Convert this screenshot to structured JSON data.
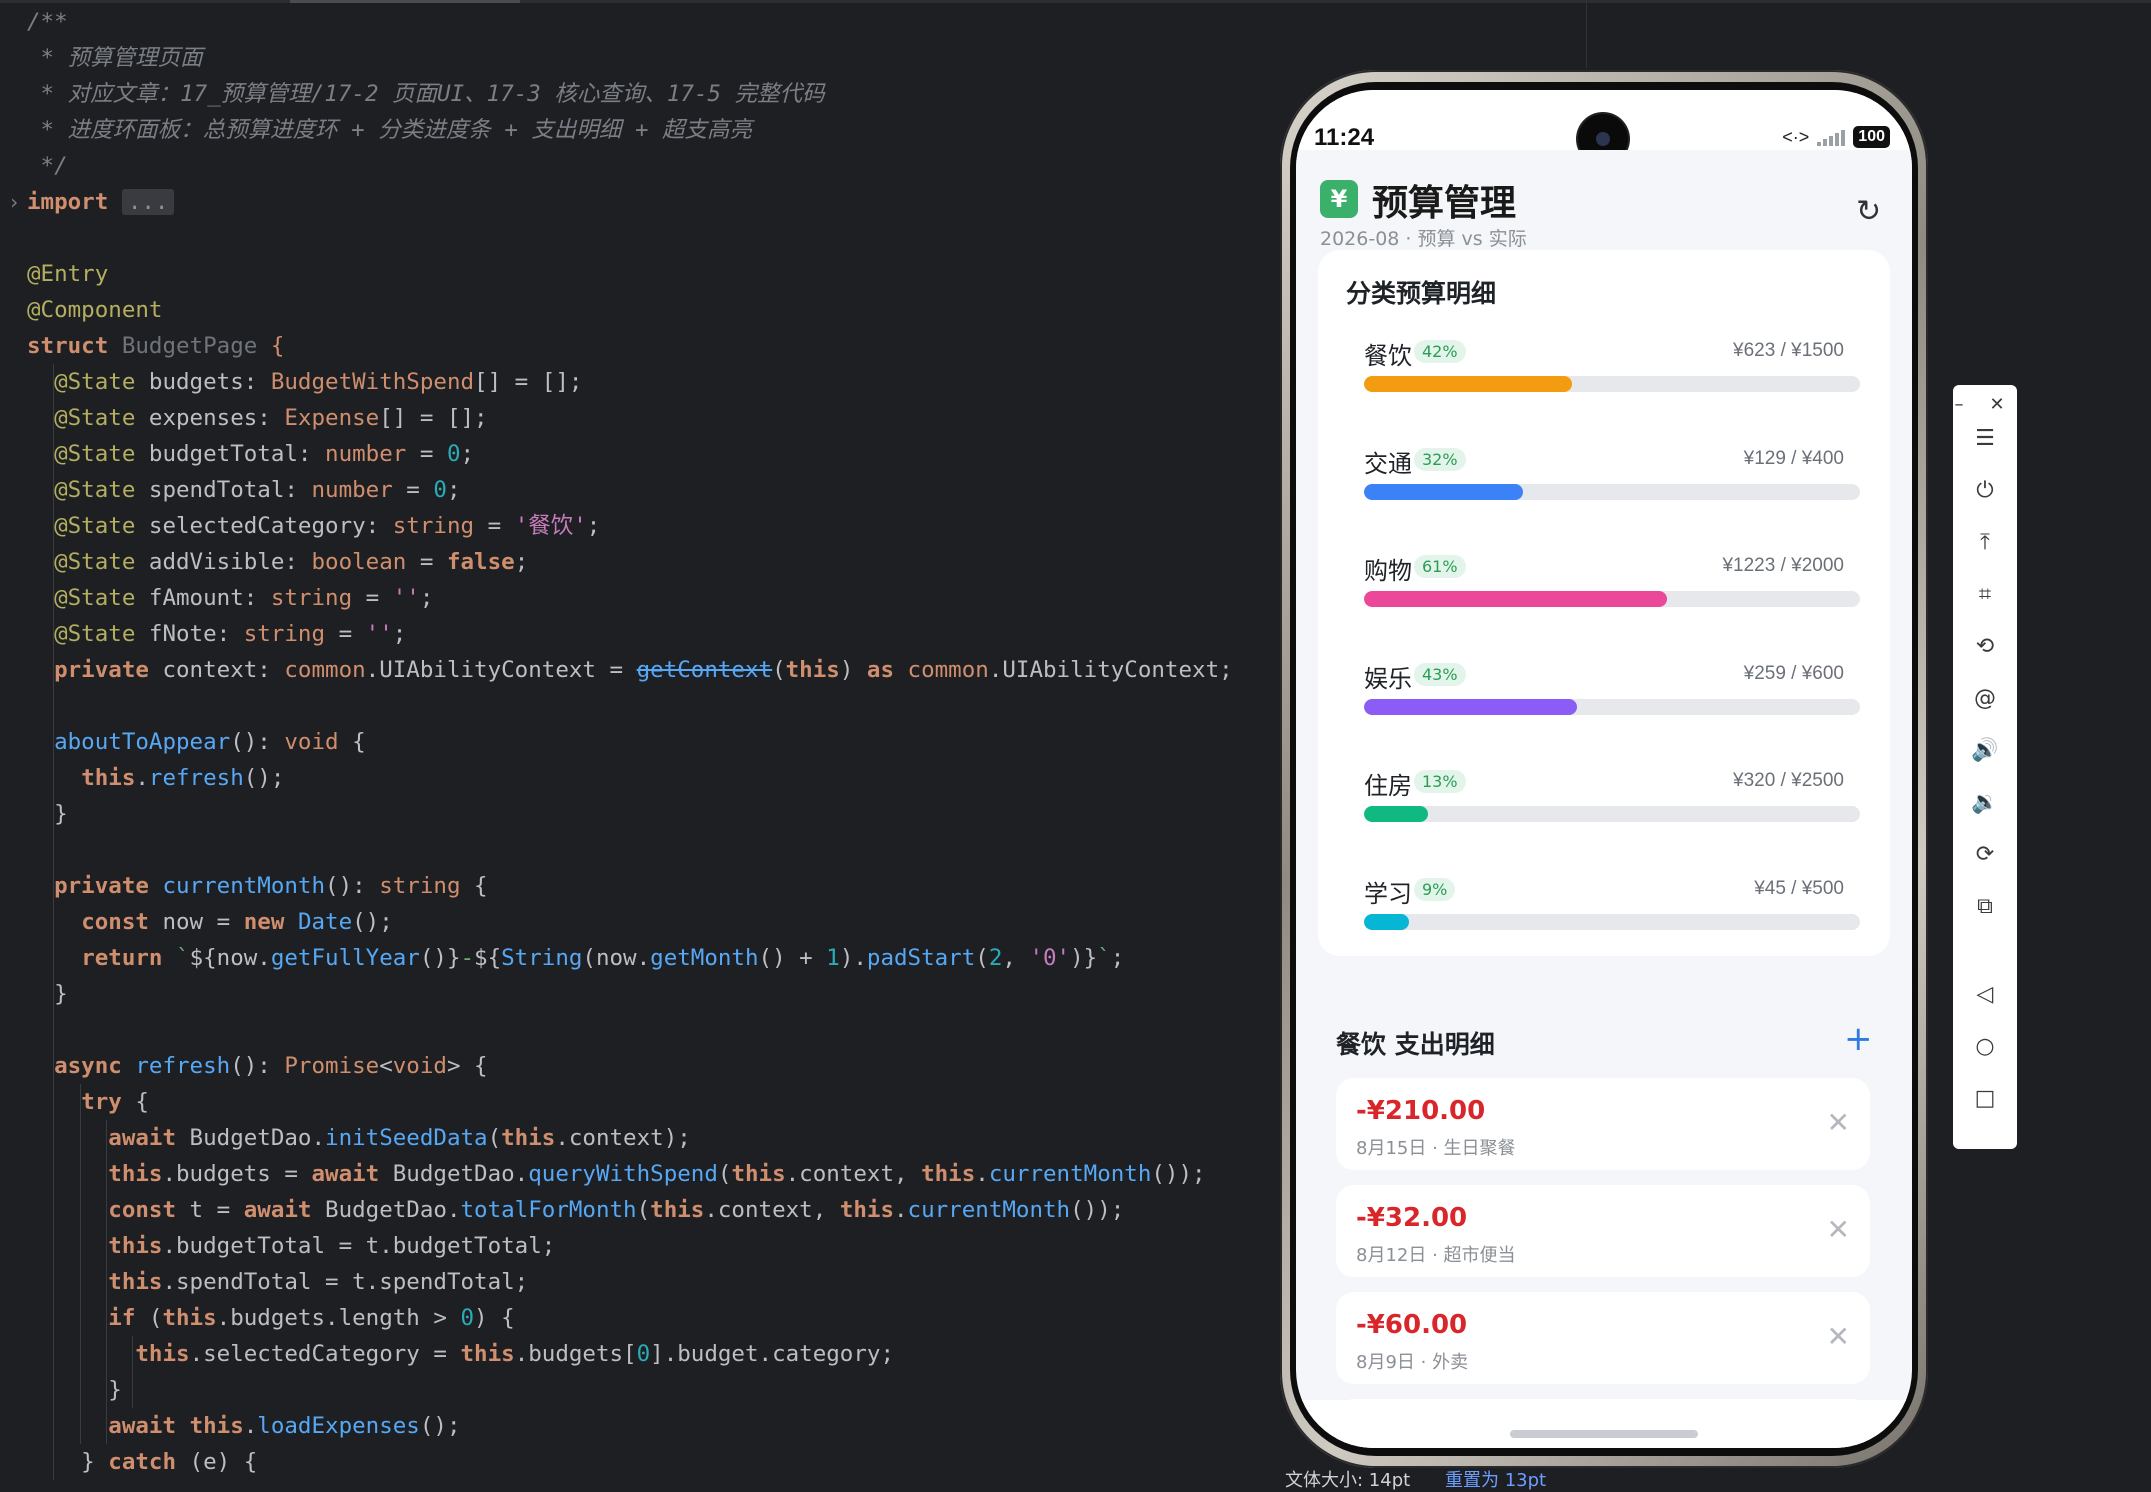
{
  "editor": {
    "lines": [
      {
        "n": 0,
        "html": "<span class=\"cm\">/**</span>"
      },
      {
        "n": 1,
        "html": "<span class=\"cm\"> * 预算管理页面</span>"
      },
      {
        "n": 2,
        "html": "<span class=\"cm\"> * 对应文章：17_预算管理/17-2 页面UI、17-3 核心查询、17-5 完整代码</span>"
      },
      {
        "n": 3,
        "html": "<span class=\"cm\"> * 进度环面板：总预算进度环 + 分类进度条 + 支出明细 + 超支高亮</span>"
      },
      {
        "n": 4,
        "html": "<span class=\"cm\"> */</span>"
      },
      {
        "n": 5,
        "html": "<span class=\"kwb\">import</span> <span class=\"fold-box\">...</span>"
      },
      {
        "n": 7,
        "html": "<span class=\"dec\">@Entry</span>"
      },
      {
        "n": 8,
        "html": "<span class=\"dec\">@Component</span>"
      },
      {
        "n": 9,
        "html": "<span class=\"kwb\">struct</span> <span class=\"cls\">BudgetPage</span> <span class=\"kw\">{</span>"
      },
      {
        "n": 10,
        "html": "  <span class=\"dec\">@State</span> budgets: <span class=\"ity\">BudgetWithSpend</span>[] = [];"
      },
      {
        "n": 11,
        "html": "  <span class=\"dec\">@State</span> expenses: <span class=\"ity\">Expense</span>[] = [];"
      },
      {
        "n": 12,
        "html": "  <span class=\"dec\">@State</span> budgetTotal: <span class=\"kw\">number</span> = <span class=\"num\">0</span>;"
      },
      {
        "n": 13,
        "html": "  <span class=\"dec\">@State</span> spendTotal: <span class=\"kw\">number</span> = <span class=\"num\">0</span>;"
      },
      {
        "n": 14,
        "html": "  <span class=\"dec\">@State</span> selectedCategory: <span class=\"kw\">string</span> = <span class=\"ty\">'餐饮'</span>;"
      },
      {
        "n": 15,
        "html": "  <span class=\"dec\">@State</span> addVisible: <span class=\"kw\">boolean</span> = <span class=\"kwb\">false</span>;"
      },
      {
        "n": 16,
        "html": "  <span class=\"dec\">@State</span> fAmount: <span class=\"kw\">string</span> = <span class=\"ty\">''</span>;"
      },
      {
        "n": 17,
        "html": "  <span class=\"dec\">@State</span> fNote: <span class=\"kw\">string</span> = <span class=\"ty\">''</span>;"
      },
      {
        "n": 18,
        "html": "  <span class=\"kwb\">private</span> context: <span class=\"ity\">common</span>.UIAbilityContext = <span class=\"strike\">getContext</span>(<span class=\"kwb\">this</span>) <span class=\"kwb\">as</span> <span class=\"ity\">common</span>.UIAbilityContext;"
      },
      {
        "n": 20,
        "html": "  <span class=\"fn\">aboutToAppear</span>(): <span class=\"kw\">void</span> {"
      },
      {
        "n": 21,
        "html": "    <span class=\"kwb\">this</span>.<span class=\"fn\">refresh</span>();"
      },
      {
        "n": 22,
        "html": "  }"
      },
      {
        "n": 24,
        "html": "  <span class=\"kwb\">private</span> <span class=\"fn\">currentMonth</span>(): <span class=\"kw\">string</span> {"
      },
      {
        "n": 25,
        "html": "    <span class=\"kwb\">const</span> now = <span class=\"kwb\">new</span> <span class=\"fn\">Date</span>();"
      },
      {
        "n": 26,
        "html": "    <span class=\"kwb\">return</span> <span class=\"str\">`</span>${now.<span class=\"fn\">getFullYear</span>()}<span class=\"str\">-</span>${<span class=\"fn\">String</span>(now.<span class=\"fn\">getMonth</span>() + <span class=\"num\">1</span>).<span class=\"fn\">padStart</span>(<span class=\"num\">2</span>, <span class=\"ty\">'0'</span>)}<span class=\"str\">`</span>;"
      },
      {
        "n": 27,
        "html": "  }"
      },
      {
        "n": 29,
        "html": "  <span class=\"kwb\">async</span> <span class=\"fn\">refresh</span>(): <span class=\"ity\">Promise</span>&lt;<span class=\"kw\">void</span>&gt; {"
      },
      {
        "n": 30,
        "html": "    <span class=\"kwb\">try</span> {"
      },
      {
        "n": 31,
        "html": "      <span class=\"kwb\">await</span> BudgetDao.<span class=\"fn\">initSeedData</span>(<span class=\"kwb\">this</span>.context);"
      },
      {
        "n": 32,
        "html": "      <span class=\"kwb\">this</span>.budgets = <span class=\"kwb\">await</span> BudgetDao.<span class=\"fn\">queryWithSpend</span>(<span class=\"kwb\">this</span>.context, <span class=\"kwb\">this</span>.<span class=\"fn\">currentMonth</span>());"
      },
      {
        "n": 33,
        "html": "      <span class=\"kwb\">const</span> t = <span class=\"kwb\">await</span> BudgetDao.<span class=\"fn\">totalForMonth</span>(<span class=\"kwb\">this</span>.context, <span class=\"kwb\">this</span>.<span class=\"fn\">currentMonth</span>());"
      },
      {
        "n": 34,
        "html": "      <span class=\"kwb\">this</span>.budgetTotal = t.budgetTotal;"
      },
      {
        "n": 35,
        "html": "      <span class=\"kwb\">this</span>.spendTotal = t.spendTotal;"
      },
      {
        "n": 36,
        "html": "      <span class=\"kwb\">if</span> (<span class=\"kwb\">this</span>.budgets.length &gt; <span class=\"num\">0</span>) {"
      },
      {
        "n": 37,
        "html": "        <span class=\"kwb\">this</span>.selectedCategory = <span class=\"kwb\">this</span>.budgets[<span class=\"num\">0</span>].budget.category;"
      },
      {
        "n": 38,
        "html": "      }"
      },
      {
        "n": 39,
        "html": "      <span class=\"kwb\">await</span> <span class=\"kwb\">this</span>.<span class=\"fn\">loadExpenses</span>();"
      },
      {
        "n": 40,
        "html": "    } <span class=\"kwb\">catch</span> (e) {"
      }
    ]
  },
  "phone": {
    "status": {
      "time": "11:24",
      "battery": "100"
    },
    "header": {
      "logo": "¥",
      "title": "预算管理",
      "subtitle": "2026-08 · 预算 vs 实际",
      "refresh_icon": "↻"
    },
    "budget_card": {
      "title": "分类预算明细",
      "items": [
        {
          "name": "餐饮",
          "pct": "42%",
          "amount": "¥623 / ¥1500",
          "fraction": 0.42,
          "color": "#f39c12"
        },
        {
          "name": "交通",
          "pct": "32%",
          "amount": "¥129 / ¥400",
          "fraction": 0.32,
          "color": "#3b82f6"
        },
        {
          "name": "购物",
          "pct": "61%",
          "amount": "¥1223 / ¥2000",
          "fraction": 0.61,
          "color": "#ec4899"
        },
        {
          "name": "娱乐",
          "pct": "43%",
          "amount": "¥259 / ¥600",
          "fraction": 0.43,
          "color": "#8b5cf6"
        },
        {
          "name": "住房",
          "pct": "13%",
          "amount": "¥320 / ¥2500",
          "fraction": 0.13,
          "color": "#10b981"
        },
        {
          "name": "学习",
          "pct": "9%",
          "amount": "¥45 / ¥500",
          "fraction": 0.09,
          "color": "#06b6d4"
        }
      ]
    },
    "expense_section": {
      "title": "餐饮 支出明细",
      "add_icon": "+",
      "items": [
        {
          "amount": "-¥210.00",
          "note": "8月15日 · 生日聚餐"
        },
        {
          "amount": "-¥32.00",
          "note": "8月12日 · 超市便当"
        },
        {
          "amount": "-¥60.00",
          "note": "8月9日 · 外卖"
        }
      ],
      "delete_icon": "✕"
    }
  },
  "toolbar": {
    "minimize": "–",
    "close": "✕",
    "buttons": [
      {
        "name": "menu-icon",
        "glyph": "☰"
      },
      {
        "name": "power-icon",
        "glyph": "⏻"
      },
      {
        "name": "pin-top-icon",
        "glyph": "⤒"
      },
      {
        "name": "crop-icon",
        "glyph": "⌗"
      },
      {
        "name": "rotate-icon",
        "glyph": "⟲"
      },
      {
        "name": "at-icon",
        "glyph": "@"
      },
      {
        "name": "volume-up-icon",
        "glyph": "🔊"
      },
      {
        "name": "volume-down-icon",
        "glyph": "🔉"
      },
      {
        "name": "shake-icon",
        "glyph": "⟳"
      },
      {
        "name": "screenshot-icon",
        "glyph": "⧉"
      }
    ],
    "nav": [
      {
        "name": "back-icon",
        "glyph": "◁"
      },
      {
        "name": "home-icon",
        "glyph": "○"
      },
      {
        "name": "recents-icon",
        "glyph": "□"
      }
    ]
  },
  "footer": {
    "font_size": "文体大小: 14pt",
    "reset": "重置为 13pt"
  }
}
